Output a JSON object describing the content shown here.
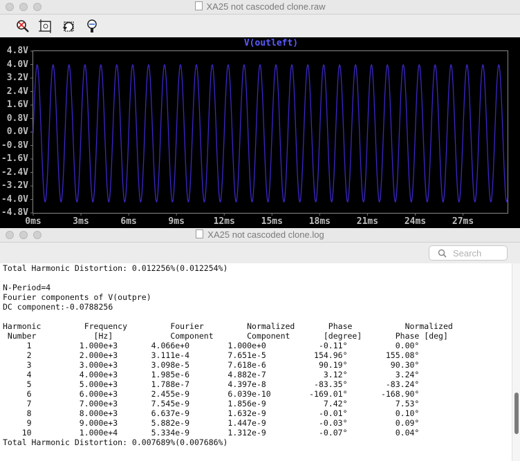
{
  "raw_window": {
    "title": "XA25 not cascoded clone.raw",
    "toolbar": {
      "icons": [
        "zoom-cancel-icon",
        "zoom-full-extent-icon",
        "undo-zoom-icon",
        "autorange-icon"
      ]
    },
    "plot": {
      "trace_label": "V(outleft)",
      "trace_color": "#3a28c8",
      "background": "#000000",
      "grid_color": "#7a7a7a",
      "label_color": "#bdbdbd",
      "y_ticks": [
        "4.8V",
        "4.0V",
        "3.2V",
        "2.4V",
        "1.6V",
        "0.8V",
        "0.0V",
        "-0.8V",
        "-1.6V",
        "-2.4V",
        "-3.2V",
        "-4.0V",
        "-4.8V"
      ],
      "x_ticks": [
        "0ms",
        "3ms",
        "6ms",
        "9ms",
        "12ms",
        "15ms",
        "18ms",
        "21ms",
        "24ms",
        "27ms"
      ]
    }
  },
  "chart_data": {
    "type": "line",
    "title": "V(outleft)",
    "xlabel": "",
    "ylabel": "",
    "x_unit": "ms",
    "y_unit": "V",
    "xlim": [
      0,
      29.8
    ],
    "ylim": [
      -4.8,
      4.8
    ],
    "grid": false,
    "series": [
      {
        "name": "V(outleft)",
        "waveform": "sine",
        "frequency_hz": 1000,
        "amplitude_v": 4.066,
        "offset_v": -0.08,
        "x_start_ms": 0,
        "x_end_ms": 29.8,
        "cycles_shown": 30
      }
    ]
  },
  "log_window": {
    "title": "XA25 not cascoded clone.log",
    "search_placeholder": "Search",
    "top_thd": "Total Harmonic Distortion: 0.012256%(0.012254%)",
    "n_period": "N-Period=4",
    "fourier_title": "Fourier components of V(outpre)",
    "dc_component": "DC component:-0.0788256",
    "table": {
      "headers_line1": [
        "Harmonic",
        "Frequency",
        "Fourier",
        "Normalized",
        "Phase",
        "Normalized"
      ],
      "headers_line2": [
        "Number",
        "[Hz]",
        "Component",
        "Component",
        "[degree]",
        "Phase [deg]"
      ],
      "rows": [
        [
          "1",
          "1.000e+3",
          "4.066e+0",
          "1.000e+0",
          "-0.11°",
          "0.00°"
        ],
        [
          "2",
          "2.000e+3",
          "3.111e-4",
          "7.651e-5",
          "154.96°",
          "155.08°"
        ],
        [
          "3",
          "3.000e+3",
          "3.098e-5",
          "7.618e-6",
          "90.19°",
          "90.30°"
        ],
        [
          "4",
          "4.000e+3",
          "1.985e-6",
          "4.882e-7",
          "3.12°",
          "3.24°"
        ],
        [
          "5",
          "5.000e+3",
          "1.788e-7",
          "4.397e-8",
          "-83.35°",
          "-83.24°"
        ],
        [
          "6",
          "6.000e+3",
          "2.455e-9",
          "6.039e-10",
          "-169.01°",
          "-168.90°"
        ],
        [
          "7",
          "7.000e+3",
          "7.545e-9",
          "1.856e-9",
          "7.42°",
          "7.53°"
        ],
        [
          "8",
          "8.000e+3",
          "6.637e-9",
          "1.632e-9",
          "-0.01°",
          "0.10°"
        ],
        [
          "9",
          "9.000e+3",
          "5.882e-9",
          "1.447e-9",
          "-0.03°",
          "0.09°"
        ],
        [
          "10",
          "1.000e+4",
          "5.334e-9",
          "1.312e-9",
          "-0.07°",
          "0.04°"
        ]
      ]
    },
    "bottom_thd": "Total Harmonic Distortion: 0.007689%(0.007686%)"
  }
}
